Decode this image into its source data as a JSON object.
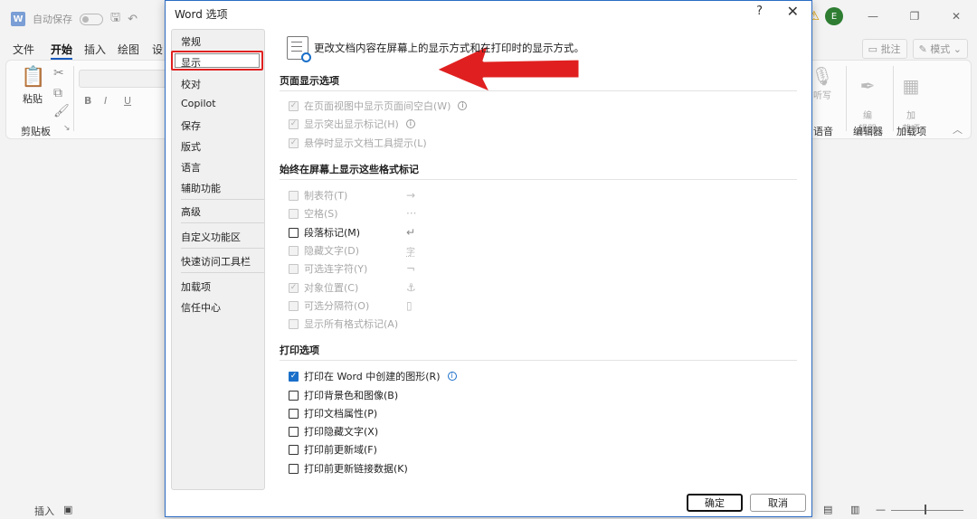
{
  "app": {
    "logo_letter": "W",
    "autosave_label": "自动保存",
    "avatar_letter": "E",
    "tabs": [
      "文件",
      "开始",
      "插入",
      "绘图",
      "设"
    ],
    "active_tab_index": 1,
    "right_buttons": [
      "批注",
      "模式"
    ],
    "ribbon": {
      "paste_label": "粘贴",
      "clipboard_label": "剪贴板",
      "right_items": [
        {
          "label": "听写",
          "group": "语音"
        },
        {
          "label": "编\n辑器",
          "group": "编辑器"
        },
        {
          "label": "加\n载项",
          "group": "加载项"
        }
      ]
    },
    "status": {
      "insert_label": "插入"
    }
  },
  "dialog": {
    "title": "Word 选项",
    "help": "?",
    "close": "✕",
    "nav": [
      "常规",
      "显示",
      "校对",
      "Copilot",
      "保存",
      "版式",
      "语言",
      "辅助功能",
      "高级",
      "自定义功能区",
      "快速访问工具栏",
      "加载项",
      "信任中心"
    ],
    "selected_nav_index": 1,
    "header_text": "更改文档内容在屏幕上的显示方式和在打印时的显示方式。",
    "sections": {
      "page_display": {
        "title": "页面显示选项",
        "options": [
          {
            "label": "在页面视图中显示页面间空白(W)",
            "checked": true,
            "disabled": true,
            "info": true
          },
          {
            "label": "显示突出显示标记(H)",
            "checked": true,
            "disabled": true,
            "info": true
          },
          {
            "label": "悬停时显示文档工具提示(L)",
            "checked": true,
            "disabled": true,
            "info": false
          }
        ]
      },
      "format_marks": {
        "title": "始终在屏幕上显示这些格式标记",
        "options": [
          {
            "label": "制表符(T)",
            "checked": false,
            "disabled": true,
            "symbol": "→"
          },
          {
            "label": "空格(S)",
            "checked": false,
            "disabled": true,
            "symbol": "···"
          },
          {
            "label": "段落标记(M)",
            "checked": false,
            "disabled": false,
            "symbol": "↵"
          },
          {
            "label": "隐藏文字(D)",
            "checked": false,
            "disabled": true,
            "symbol": "字"
          },
          {
            "label": "可选连字符(Y)",
            "checked": false,
            "disabled": true,
            "symbol": "¬"
          },
          {
            "label": "对象位置(C)",
            "checked": true,
            "disabled": true,
            "symbol": "⚓"
          },
          {
            "label": "可选分隔符(O)",
            "checked": false,
            "disabled": true,
            "symbol": "▯"
          },
          {
            "label": "显示所有格式标记(A)",
            "checked": false,
            "disabled": true,
            "symbol": ""
          }
        ]
      },
      "print": {
        "title": "打印选项",
        "options": [
          {
            "label": "打印在 Word 中创建的图形(R)",
            "checked": true,
            "disabled": false,
            "info": true
          },
          {
            "label": "打印背景色和图像(B)",
            "checked": false,
            "disabled": false,
            "info": false
          },
          {
            "label": "打印文档属性(P)",
            "checked": false,
            "disabled": false,
            "info": false
          },
          {
            "label": "打印隐藏文字(X)",
            "checked": false,
            "disabled": false,
            "info": false
          },
          {
            "label": "打印前更新域(F)",
            "checked": false,
            "disabled": false,
            "info": false
          },
          {
            "label": "打印前更新链接数据(K)",
            "checked": false,
            "disabled": false,
            "info": false
          }
        ]
      }
    },
    "ok_label": "确定",
    "cancel_label": "取消"
  },
  "colors": {
    "accent": "#1a6fc9",
    "highlight": "#e02020"
  }
}
